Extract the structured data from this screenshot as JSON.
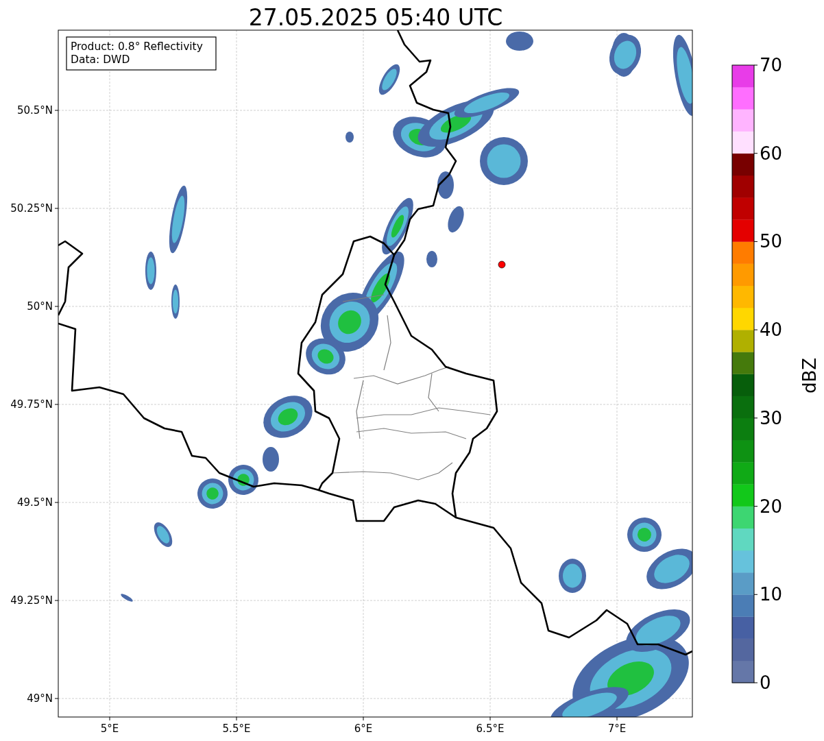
{
  "title": "27.05.2025 05:40 UTC",
  "info_box": [
    "Product: 0.8° Reflectivity",
    "Data: DWD"
  ],
  "map": {
    "yticks": [
      "50.5°N",
      "50.25°N",
      "50°N",
      "49.75°N",
      "49.5°N",
      "49.25°N",
      "49°N"
    ],
    "xticks": [
      "5°E",
      "5.5°E",
      "6°E",
      "6.5°E",
      "7°E"
    ]
  },
  "colorbar": {
    "ticks": [
      "70",
      "60",
      "50",
      "40",
      "30",
      "20",
      "10",
      "0"
    ],
    "label": "dBZ",
    "bins": [
      {
        "color": "#6577a8"
      },
      {
        "color": "#54679f"
      },
      {
        "color": "#4760a3"
      },
      {
        "color": "#4b7db5"
      },
      {
        "color": "#5a9cc6"
      },
      {
        "color": "#66c2dc"
      },
      {
        "color": "#60d8c0"
      },
      {
        "color": "#3dd672"
      },
      {
        "color": "#12c81a"
      },
      {
        "color": "#10aa16"
      },
      {
        "color": "#0e9213"
      },
      {
        "color": "#0c7e10"
      },
      {
        "color": "#0a6f0e"
      },
      {
        "color": "#075e0b"
      },
      {
        "color": "#457a0c"
      },
      {
        "color": "#b0b000"
      },
      {
        "color": "#ffd700"
      },
      {
        "color": "#ffb800"
      },
      {
        "color": "#ff9a00"
      },
      {
        "color": "#ff7c00"
      },
      {
        "color": "#e40000"
      },
      {
        "color": "#c00000"
      },
      {
        "color": "#a00000"
      },
      {
        "color": "#780000"
      },
      {
        "color": "#ffe0ff"
      },
      {
        "color": "#ffb4ff"
      },
      {
        "color": "#ff6eff"
      },
      {
        "color": "#e83ce8"
      }
    ]
  }
}
